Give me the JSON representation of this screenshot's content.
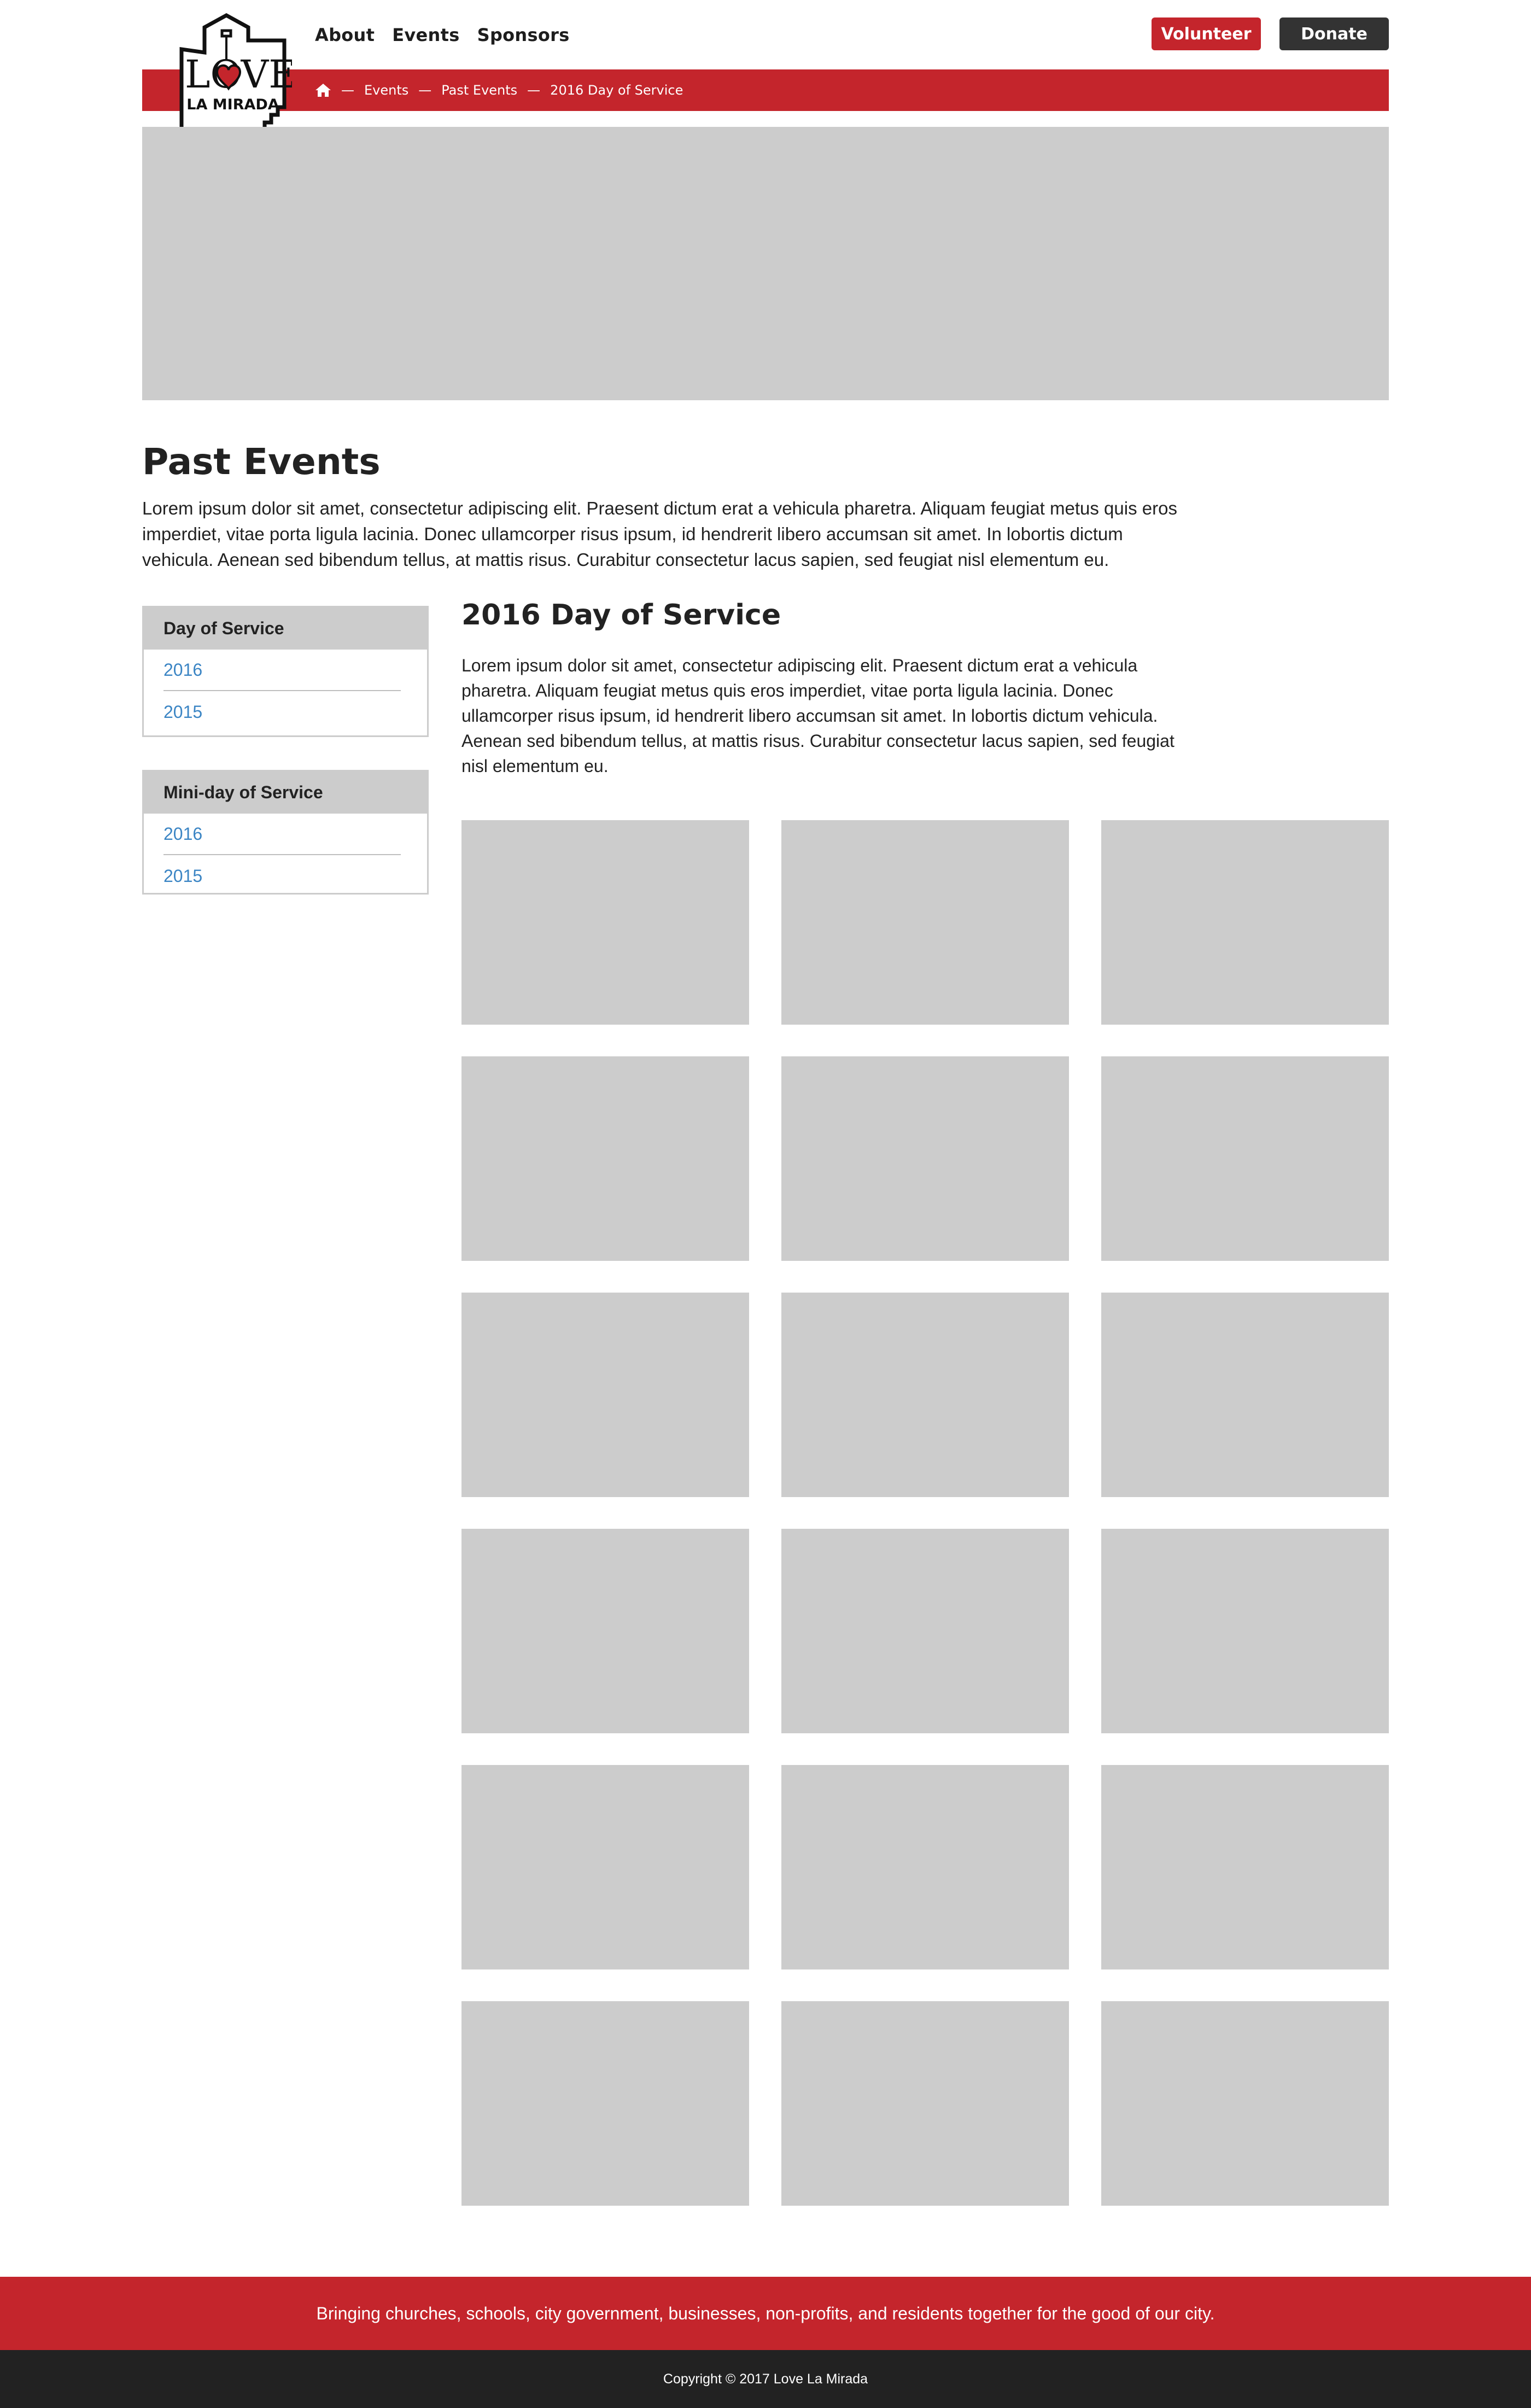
{
  "brand": {
    "logo_line1": "LOVE",
    "logo_line2": "LA MIRADA",
    "accent_color": "#c4252c",
    "dark_color": "#333333",
    "link_color": "#3b85c4"
  },
  "nav": {
    "items": [
      {
        "label": "About"
      },
      {
        "label": "Events"
      },
      {
        "label": "Sponsors"
      }
    ],
    "volunteer_label": "Volunteer",
    "donate_label": "Donate"
  },
  "breadcrumb": {
    "home_icon": "home-icon",
    "separator": "—",
    "items": [
      {
        "label": "Events"
      },
      {
        "label": "Past Events"
      },
      {
        "label": "2016 Day of Service"
      }
    ]
  },
  "page": {
    "title": "Past Events",
    "intro": "Lorem ipsum dolor sit amet, consectetur adipiscing elit. Praesent dictum erat a vehicula pharetra. Aliquam feugiat metus quis eros imperdiet, vitae porta ligula lacinia. Donec ullamcorper risus ipsum, id hendrerit libero accumsan sit amet. In lobortis dictum vehicula. Aenean sed bibendum tellus, at mattis risus. Curabitur consectetur lacus sapien, sed feugiat nisl elementum eu."
  },
  "sidebar": {
    "groups": [
      {
        "title": "Day of Service",
        "items": [
          {
            "label": "2016"
          },
          {
            "label": "2015"
          }
        ]
      },
      {
        "title": "Mini-day of Service",
        "items": [
          {
            "label": "2016"
          },
          {
            "label": "2015"
          }
        ]
      }
    ]
  },
  "content": {
    "title": "2016 Day of Service",
    "text": "Lorem ipsum dolor sit amet, consectetur adipiscing elit. Praesent dictum erat a vehicula pharetra. Aliquam feugiat metus quis eros imperdiet, vitae porta ligula lacinia. Donec ullamcorper risus ipsum, id hendrerit libero accumsan sit amet. In lobortis dictum vehicula. Aenean sed bibendum tellus, at mattis risus. Curabitur consectetur lacus sapien, sed feugiat nisl elementum eu."
  },
  "footer": {
    "tagline": "Bringing churches, schools, city government, businesses, non-profits, and residents together for the good of our city.",
    "copyright": "Copyright © 2017 Love La Mirada"
  }
}
